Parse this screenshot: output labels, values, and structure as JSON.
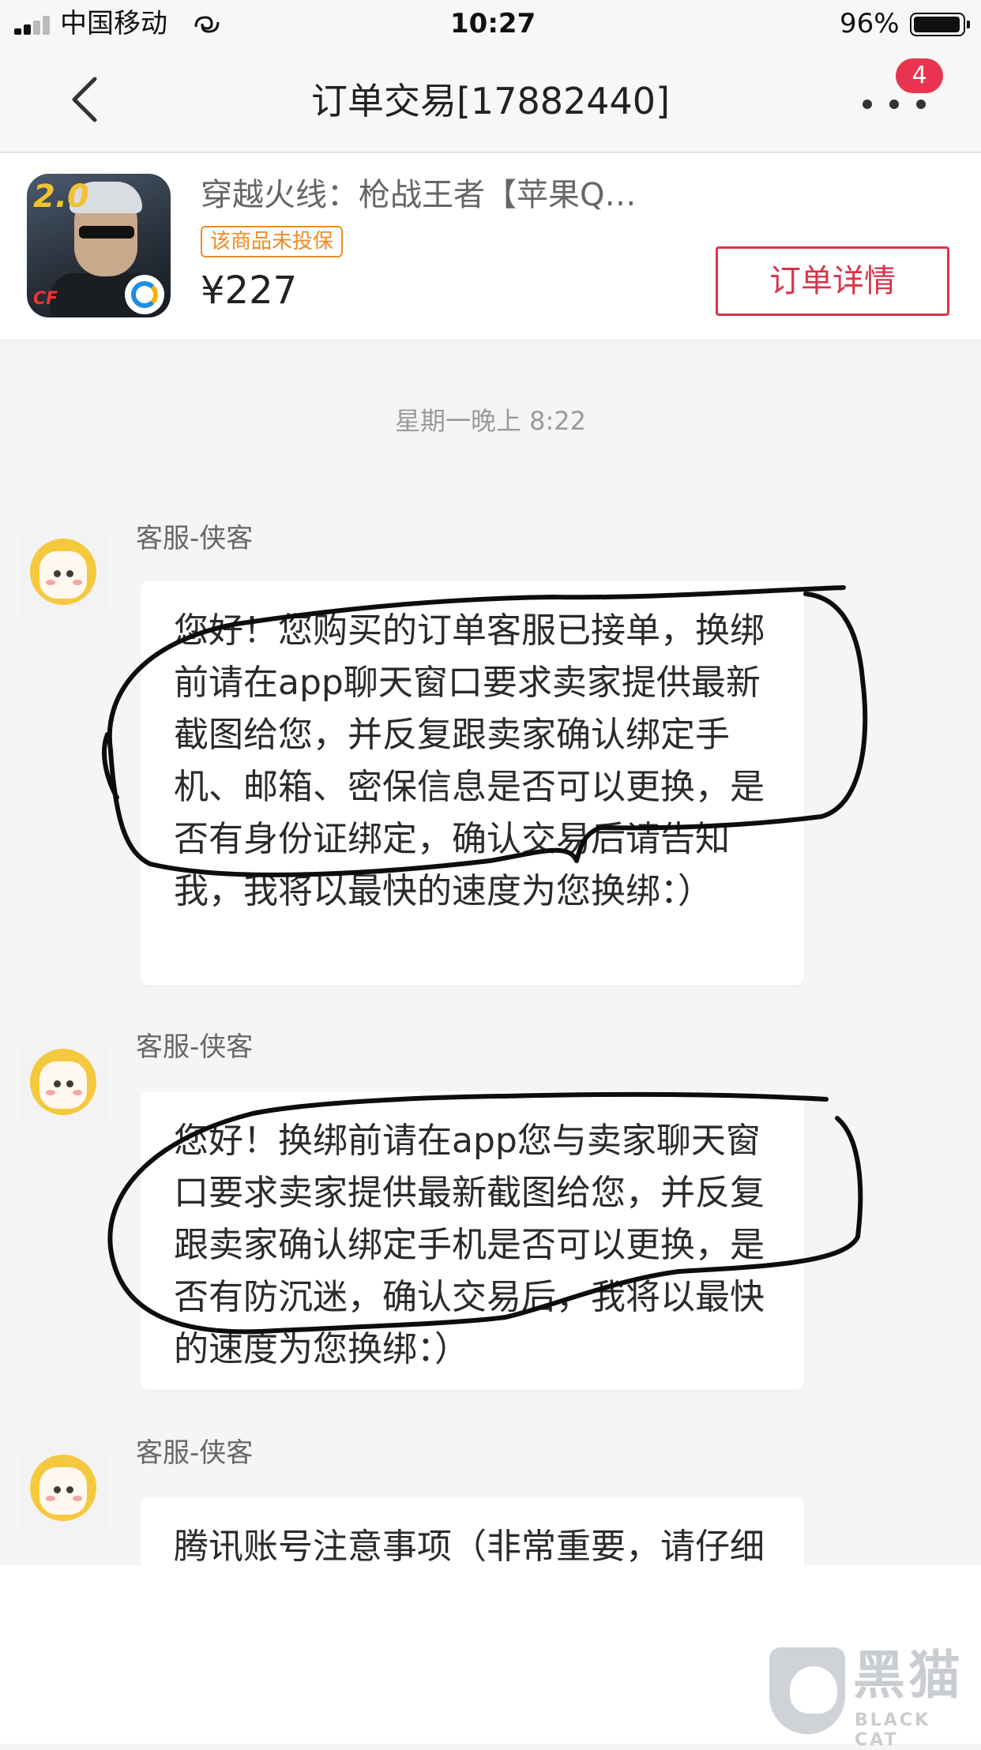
{
  "status_bar": {
    "carrier": "中国移动",
    "time": "10:27",
    "battery": "96%",
    "battery_level": 0.96
  },
  "header": {
    "title": "订单交易[17882440]",
    "more_badge": "4"
  },
  "product": {
    "icon_badge": "2.0",
    "icon_logo": "CF",
    "title": "穿越火线：枪战王者【苹果Q…",
    "insurance_tag": "该商品未投保",
    "price": "¥227",
    "detail_button": "订单详情"
  },
  "chat": {
    "timestamp": "星期一晚上 8:22",
    "messages": [
      {
        "sender": "客服-侠客",
        "text": "您好！您购买的订单客服已接单，换绑前请在app聊天窗口要求卖家提供最新截图给您，并反复跟卖家确认绑定手机、邮箱、密保信息是否可以更换，是否有身份证绑定，确认交易后请告知我，我将以最快的速度为您换绑：）"
      },
      {
        "sender": "客服-侠客",
        "text": "您好！换绑前请在app您与卖家聊天窗口要求卖家提供最新截图给您，并反复跟卖家确认绑定手机是否可以更换，是否有防沉迷，确认交易后，我将以最快的速度为您换绑：）"
      },
      {
        "sender": "客服-侠客",
        "text": "腾讯账号注意事项（非常重要，请仔细阅读）腾讯账号本平台交易设置"
      }
    ]
  },
  "watermark": {
    "cn": "黑猫",
    "en": "BLACK CAT"
  },
  "colors": {
    "accent_red": "#d8344a",
    "badge_red": "#e8344e",
    "tag_orange": "#f08a24",
    "avatar_yellow": "#f5c93e"
  }
}
